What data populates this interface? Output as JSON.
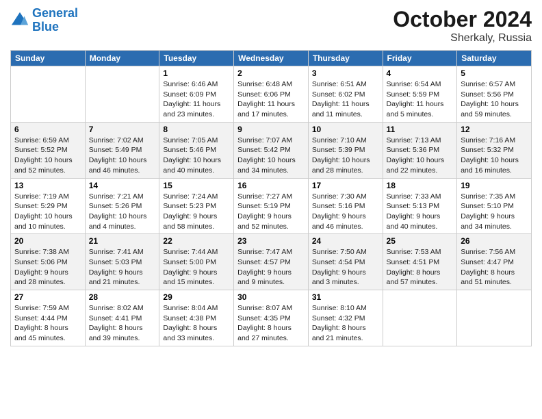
{
  "header": {
    "logo_general": "General",
    "logo_blue": "Blue",
    "month_title": "October 2024",
    "location": "Sherkaly, Russia"
  },
  "weekdays": [
    "Sunday",
    "Monday",
    "Tuesday",
    "Wednesday",
    "Thursday",
    "Friday",
    "Saturday"
  ],
  "weeks": [
    [
      null,
      null,
      {
        "day": 1,
        "sunrise": "6:46 AM",
        "sunset": "6:09 PM",
        "daylight": "11 hours and 23 minutes."
      },
      {
        "day": 2,
        "sunrise": "6:48 AM",
        "sunset": "6:06 PM",
        "daylight": "11 hours and 17 minutes."
      },
      {
        "day": 3,
        "sunrise": "6:51 AM",
        "sunset": "6:02 PM",
        "daylight": "11 hours and 11 minutes."
      },
      {
        "day": 4,
        "sunrise": "6:54 AM",
        "sunset": "5:59 PM",
        "daylight": "11 hours and 5 minutes."
      },
      {
        "day": 5,
        "sunrise": "6:57 AM",
        "sunset": "5:56 PM",
        "daylight": "10 hours and 59 minutes."
      }
    ],
    [
      {
        "day": 6,
        "sunrise": "6:59 AM",
        "sunset": "5:52 PM",
        "daylight": "10 hours and 52 minutes."
      },
      {
        "day": 7,
        "sunrise": "7:02 AM",
        "sunset": "5:49 PM",
        "daylight": "10 hours and 46 minutes."
      },
      {
        "day": 8,
        "sunrise": "7:05 AM",
        "sunset": "5:46 PM",
        "daylight": "10 hours and 40 minutes."
      },
      {
        "day": 9,
        "sunrise": "7:07 AM",
        "sunset": "5:42 PM",
        "daylight": "10 hours and 34 minutes."
      },
      {
        "day": 10,
        "sunrise": "7:10 AM",
        "sunset": "5:39 PM",
        "daylight": "10 hours and 28 minutes."
      },
      {
        "day": 11,
        "sunrise": "7:13 AM",
        "sunset": "5:36 PM",
        "daylight": "10 hours and 22 minutes."
      },
      {
        "day": 12,
        "sunrise": "7:16 AM",
        "sunset": "5:32 PM",
        "daylight": "10 hours and 16 minutes."
      }
    ],
    [
      {
        "day": 13,
        "sunrise": "7:19 AM",
        "sunset": "5:29 PM",
        "daylight": "10 hours and 10 minutes."
      },
      {
        "day": 14,
        "sunrise": "7:21 AM",
        "sunset": "5:26 PM",
        "daylight": "10 hours and 4 minutes."
      },
      {
        "day": 15,
        "sunrise": "7:24 AM",
        "sunset": "5:23 PM",
        "daylight": "9 hours and 58 minutes."
      },
      {
        "day": 16,
        "sunrise": "7:27 AM",
        "sunset": "5:19 PM",
        "daylight": "9 hours and 52 minutes."
      },
      {
        "day": 17,
        "sunrise": "7:30 AM",
        "sunset": "5:16 PM",
        "daylight": "9 hours and 46 minutes."
      },
      {
        "day": 18,
        "sunrise": "7:33 AM",
        "sunset": "5:13 PM",
        "daylight": "9 hours and 40 minutes."
      },
      {
        "day": 19,
        "sunrise": "7:35 AM",
        "sunset": "5:10 PM",
        "daylight": "9 hours and 34 minutes."
      }
    ],
    [
      {
        "day": 20,
        "sunrise": "7:38 AM",
        "sunset": "5:06 PM",
        "daylight": "9 hours and 28 minutes."
      },
      {
        "day": 21,
        "sunrise": "7:41 AM",
        "sunset": "5:03 PM",
        "daylight": "9 hours and 21 minutes."
      },
      {
        "day": 22,
        "sunrise": "7:44 AM",
        "sunset": "5:00 PM",
        "daylight": "9 hours and 15 minutes."
      },
      {
        "day": 23,
        "sunrise": "7:47 AM",
        "sunset": "4:57 PM",
        "daylight": "9 hours and 9 minutes."
      },
      {
        "day": 24,
        "sunrise": "7:50 AM",
        "sunset": "4:54 PM",
        "daylight": "9 hours and 3 minutes."
      },
      {
        "day": 25,
        "sunrise": "7:53 AM",
        "sunset": "4:51 PM",
        "daylight": "8 hours and 57 minutes."
      },
      {
        "day": 26,
        "sunrise": "7:56 AM",
        "sunset": "4:47 PM",
        "daylight": "8 hours and 51 minutes."
      }
    ],
    [
      {
        "day": 27,
        "sunrise": "7:59 AM",
        "sunset": "4:44 PM",
        "daylight": "8 hours and 45 minutes."
      },
      {
        "day": 28,
        "sunrise": "8:02 AM",
        "sunset": "4:41 PM",
        "daylight": "8 hours and 39 minutes."
      },
      {
        "day": 29,
        "sunrise": "8:04 AM",
        "sunset": "4:38 PM",
        "daylight": "8 hours and 33 minutes."
      },
      {
        "day": 30,
        "sunrise": "8:07 AM",
        "sunset": "4:35 PM",
        "daylight": "8 hours and 27 minutes."
      },
      {
        "day": 31,
        "sunrise": "8:10 AM",
        "sunset": "4:32 PM",
        "daylight": "8 hours and 21 minutes."
      },
      null,
      null
    ]
  ]
}
